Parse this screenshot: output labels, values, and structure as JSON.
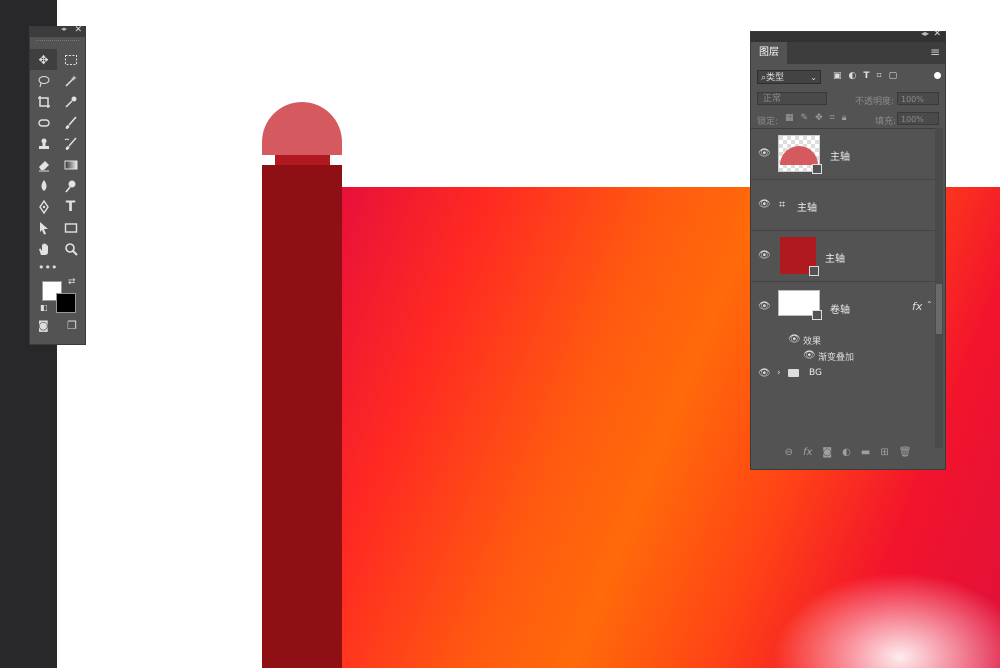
{
  "tools_panel": {
    "tools": [
      [
        "move-tool",
        "marquee-tool"
      ],
      [
        "lasso-tool",
        "magic-wand-tool"
      ],
      [
        "crop-tool",
        "eyedropper-tool"
      ],
      [
        "healing-brush-tool",
        "brush-tool"
      ],
      [
        "clone-stamp-tool",
        "history-brush-tool"
      ],
      [
        "eraser-tool",
        "gradient-tool"
      ],
      [
        "blur-tool",
        "dodge-tool"
      ],
      [
        "pen-tool",
        "type-tool"
      ],
      [
        "path-selection-tool",
        "rectangle-tool"
      ],
      [
        "hand-tool",
        "zoom-tool"
      ]
    ],
    "more": "•••",
    "foreground_color": "#ffffff",
    "background_color": "#000000"
  },
  "layers_panel": {
    "tab_label": "图层",
    "filter_kind": "类型",
    "blend_mode": "正常",
    "opacity_label": "不透明度:",
    "opacity_value": "100%",
    "lock_label": "锁定:",
    "fill_label": "填充:",
    "fill_value": "100%",
    "layers": [
      {
        "name": "主轴",
        "thumb_color": "#d45a60",
        "thumb_shape": "half-circle",
        "smart_object": true
      },
      {
        "name": "主轴",
        "thumb_color": null,
        "thumb_shape": "artboard-icon",
        "smart_object": false
      },
      {
        "name": "主轴",
        "thumb_color": "#b01a1e",
        "thumb_shape": "rect",
        "smart_object": true
      },
      {
        "name": "卷轴",
        "thumb_color": "#ffffff",
        "thumb_shape": "rect",
        "smart_object": true,
        "fx": "fx"
      }
    ],
    "effects_label": "效果",
    "effect_items": [
      "渐变叠加"
    ],
    "group_name": "BG"
  },
  "colors": {
    "rod": "#8e1015",
    "cap": "#d45a60",
    "panel_bg": "#535353"
  }
}
